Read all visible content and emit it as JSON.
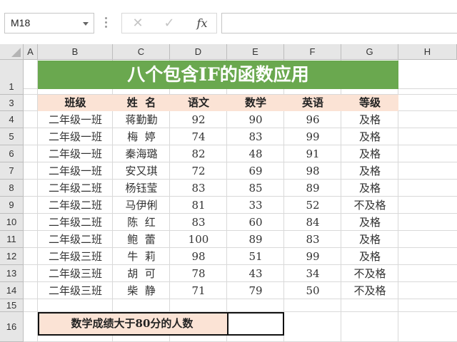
{
  "formula_bar": {
    "name_box": "M18",
    "cancel_icon": "✕",
    "enter_icon": "✓",
    "fx_label": "fx",
    "formula": ""
  },
  "columns": [
    "A",
    "B",
    "C",
    "D",
    "E",
    "F",
    "G",
    "H"
  ],
  "row_numbers": [
    "1",
    "3",
    "4",
    "5",
    "6",
    "7",
    "8",
    "9",
    "10",
    "11",
    "12",
    "13",
    "14",
    "15",
    "16"
  ],
  "title": "八个包含IF的函数应用",
  "table": {
    "headers": [
      "班级",
      "姓  名",
      "语文",
      "数学",
      "英语",
      "等级"
    ],
    "rows": [
      [
        "二年级一班",
        "蒋勤勤",
        "92",
        "90",
        "96",
        "及格"
      ],
      [
        "二年级一班",
        "梅  婷",
        "74",
        "83",
        "99",
        "及格"
      ],
      [
        "二年级一班",
        "秦海璐",
        "82",
        "48",
        "91",
        "及格"
      ],
      [
        "二年级一班",
        "安又琪",
        "72",
        "69",
        "98",
        "及格"
      ],
      [
        "二年级二班",
        "杨钰莹",
        "83",
        "85",
        "89",
        "及格"
      ],
      [
        "二年级二班",
        "马伊俐",
        "81",
        "33",
        "52",
        "不及格"
      ],
      [
        "二年级二班",
        "陈  红",
        "83",
        "60",
        "84",
        "及格"
      ],
      [
        "二年级二班",
        "鲍  蕾",
        "100",
        "89",
        "83",
        "及格"
      ],
      [
        "二年级三班",
        "牛  莉",
        "98",
        "51",
        "99",
        "及格"
      ],
      [
        "二年级三班",
        "胡  可",
        "78",
        "43",
        "34",
        "不及格"
      ],
      [
        "二年级三班",
        "柴  静",
        "71",
        "79",
        "50",
        "不及格"
      ]
    ]
  },
  "question": {
    "label": "数学成绩大于80分的人数",
    "answer": ""
  },
  "colors": {
    "title_bg": "#6aa84f",
    "header_bg": "#fbe3d5",
    "header_fill": "#e6e6e6"
  }
}
